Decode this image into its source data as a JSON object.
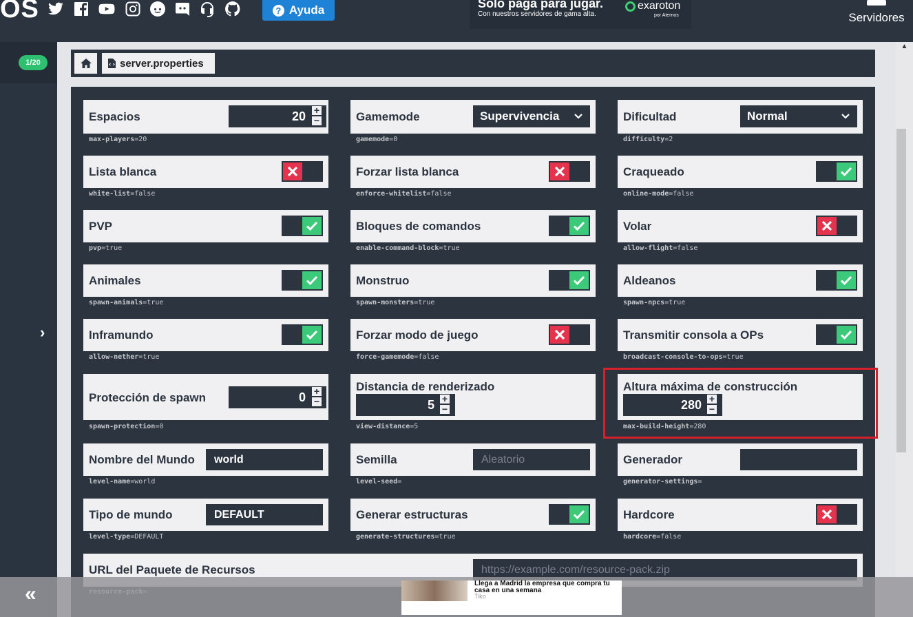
{
  "topbar": {
    "logo_text": "OS",
    "help_label": "Ayuda",
    "promo_title": "Solo paga para jugar.",
    "promo_subtitle": "Con nuestros servidores de gama alta.",
    "promo_brand": "exaroton",
    "promo_by": "por Aternos",
    "servers_label": "Servidores",
    "social_icons": [
      "twitter-icon",
      "facebook-icon",
      "youtube-icon",
      "instagram-icon",
      "reddit-icon",
      "discord-icon",
      "support-headset-icon",
      "github-icon"
    ]
  },
  "sidebar": {
    "badge": "1/20"
  },
  "breadcrumb": {
    "file": "server.properties"
  },
  "settings": {
    "max_players": {
      "label": "Espacios",
      "value": "20",
      "key": "max-players",
      "raw": "=20"
    },
    "gamemode": {
      "label": "Gamemode",
      "value": "Supervivencia",
      "key": "gamemode",
      "raw": "=0"
    },
    "difficulty": {
      "label": "Dificultad",
      "value": "Normal",
      "key": "difficulty",
      "raw": "=2"
    },
    "white_list": {
      "label": "Lista blanca",
      "key": "white-list",
      "raw": "=false",
      "on": false
    },
    "enforce_whitelist": {
      "label": "Forzar lista blanca",
      "key": "enforce-whitelist",
      "raw": "=false",
      "on": false
    },
    "online_mode": {
      "label": "Craqueado",
      "key": "online-mode",
      "raw": "=false",
      "on": true
    },
    "pvp": {
      "label": "PVP",
      "key": "pvp",
      "raw": "=true",
      "on": true
    },
    "command_block": {
      "label": "Bloques de comandos",
      "key": "enable-command-block",
      "raw": "=true",
      "on": true
    },
    "allow_flight": {
      "label": "Volar",
      "key": "allow-flight",
      "raw": "=false",
      "on": false
    },
    "spawn_animals": {
      "label": "Animales",
      "key": "spawn-animals",
      "raw": "=true",
      "on": true
    },
    "spawn_monsters": {
      "label": "Monstruo",
      "key": "spawn-monsters",
      "raw": "=true",
      "on": true
    },
    "spawn_npcs": {
      "label": "Aldeanos",
      "key": "spawn-npcs",
      "raw": "=true",
      "on": true
    },
    "allow_nether": {
      "label": "Inframundo",
      "key": "allow-nether",
      "raw": "=true",
      "on": true
    },
    "force_gamemode": {
      "label": "Forzar modo de juego",
      "key": "force-gamemode",
      "raw": "=false",
      "on": false
    },
    "broadcast_console": {
      "label": "Transmitir consola a OPs",
      "key": "broadcast-console-to-ops",
      "raw": "=true",
      "on": true
    },
    "spawn_protection": {
      "label": "Protección de spawn",
      "value": "0",
      "key": "spawn-protection",
      "raw": "=0"
    },
    "view_distance": {
      "label": "Distancia de renderizado",
      "value": "5",
      "key": "view-distance",
      "raw": "=5"
    },
    "max_build_height": {
      "label": "Altura máxima de construcción",
      "value": "280",
      "key": "max-build-height",
      "raw": "=280"
    },
    "level_name": {
      "label": "Nombre del Mundo",
      "value": "world",
      "key": "level-name",
      "raw": "=world"
    },
    "level_seed": {
      "label": "Semilla",
      "placeholder": "Aleatorio",
      "key": "level-seed",
      "raw": "="
    },
    "generator_settings": {
      "label": "Generador",
      "value": "",
      "key": "generator-settings",
      "raw": "="
    },
    "level_type": {
      "label": "Tipo de mundo",
      "value": "DEFAULT",
      "key": "level-type",
      "raw": "=DEFAULT"
    },
    "generate_structures": {
      "label": "Generar estructuras",
      "key": "generate-structures",
      "raw": "=true",
      "on": true
    },
    "hardcore": {
      "label": "Hardcore",
      "key": "hardcore",
      "raw": "=false",
      "on": false
    },
    "resource_pack": {
      "label": "URL del Paquete de Recursos",
      "placeholder": "https://example.com/resource-pack.zip",
      "key": "resource-pack",
      "raw": "="
    }
  },
  "ad": {
    "title": "Llega a Madrid la empresa que compra tu casa en una semana",
    "source": "Tiko"
  },
  "colors": {
    "accent": "#1e82d6",
    "on": "#3cc979",
    "off": "#e5334d",
    "highlight": "#d8202c",
    "badge": "#2fbf71"
  }
}
